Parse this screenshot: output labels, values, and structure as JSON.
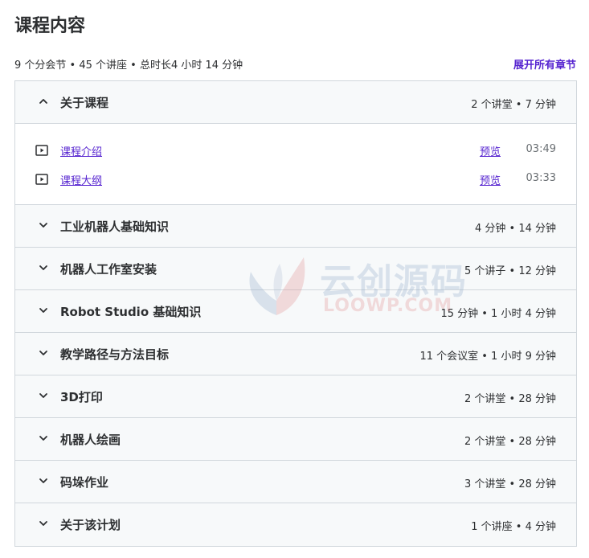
{
  "page": {
    "title": "课程内容",
    "summary": "9 个分会节 • 45 个讲座 • 总时长4 小时 14 分钟",
    "expand_all": "展开所有章节"
  },
  "sections": [
    {
      "title": "关于课程",
      "meta": "2 个讲堂 • 7 分钟",
      "expanded": true,
      "lectures": [
        {
          "title": "课程介绍",
          "preview": "预览",
          "duration": "03:49"
        },
        {
          "title": "课程大纲",
          "preview": "预览",
          "duration": "03:33"
        }
      ]
    },
    {
      "title": "工业机器人基础知识",
      "meta": "4 分钟 • 14 分钟",
      "expanded": false
    },
    {
      "title": "机器人工作室安装",
      "meta": "5 个讲子 • 12 分钟",
      "expanded": false
    },
    {
      "title": "Robot Studio 基础知识",
      "meta": "15 分钟 • 1 小时 4 分钟",
      "expanded": false
    },
    {
      "title": "教学路径与方法目标",
      "meta": "11 个会议室 • 1 小时 9 分钟",
      "expanded": false
    },
    {
      "title": "3D打印",
      "meta": "2 个讲堂 • 28 分钟",
      "expanded": false
    },
    {
      "title": "机器人绘画",
      "meta": "2 个讲堂 • 28 分钟",
      "expanded": false
    },
    {
      "title": "码垛作业",
      "meta": "3 个讲堂 • 28 分钟",
      "expanded": false
    },
    {
      "title": "关于该计划",
      "meta": "1 个讲座 • 4 分钟",
      "expanded": false
    }
  ],
  "watermark": {
    "chinese": "云创源码",
    "english": "LOOWP.COM"
  },
  "icons": {
    "chevron_up": "chevron-up-icon",
    "chevron_down": "chevron-down-icon",
    "play": "video-play-icon",
    "logo": "watermark-logo-icon"
  },
  "colors": {
    "accent": "#5624d0",
    "header_bg": "#f7f9fa",
    "border": "#d1d7dc",
    "text": "#2d2f31"
  }
}
